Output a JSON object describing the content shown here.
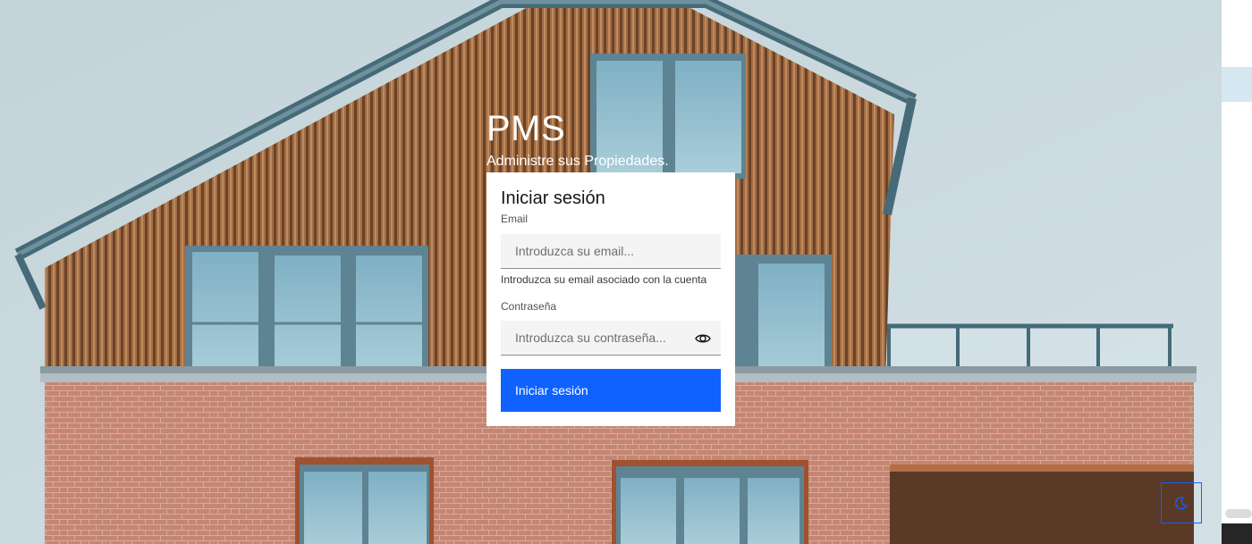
{
  "brand": {
    "title": "PMS",
    "subtitle": "Administre sus Propiedades."
  },
  "login": {
    "heading": "Iniciar sesión",
    "email": {
      "label": "Email",
      "placeholder": "Introduzca su email...",
      "value": "",
      "helper": "Introduzca su email asociado con la cuenta"
    },
    "password": {
      "label": "Contraseña",
      "placeholder": "Introduzca su contraseña...",
      "value": "",
      "toggle_icon": "eye-icon"
    },
    "submit_label": "Iniciar sesión"
  },
  "theme_toggle": {
    "icon": "moon-icon"
  },
  "colors": {
    "primary": "#0f62fe",
    "sky": "#c9d8de",
    "brick": "#c07e6c",
    "wood": "#9c6a42"
  }
}
